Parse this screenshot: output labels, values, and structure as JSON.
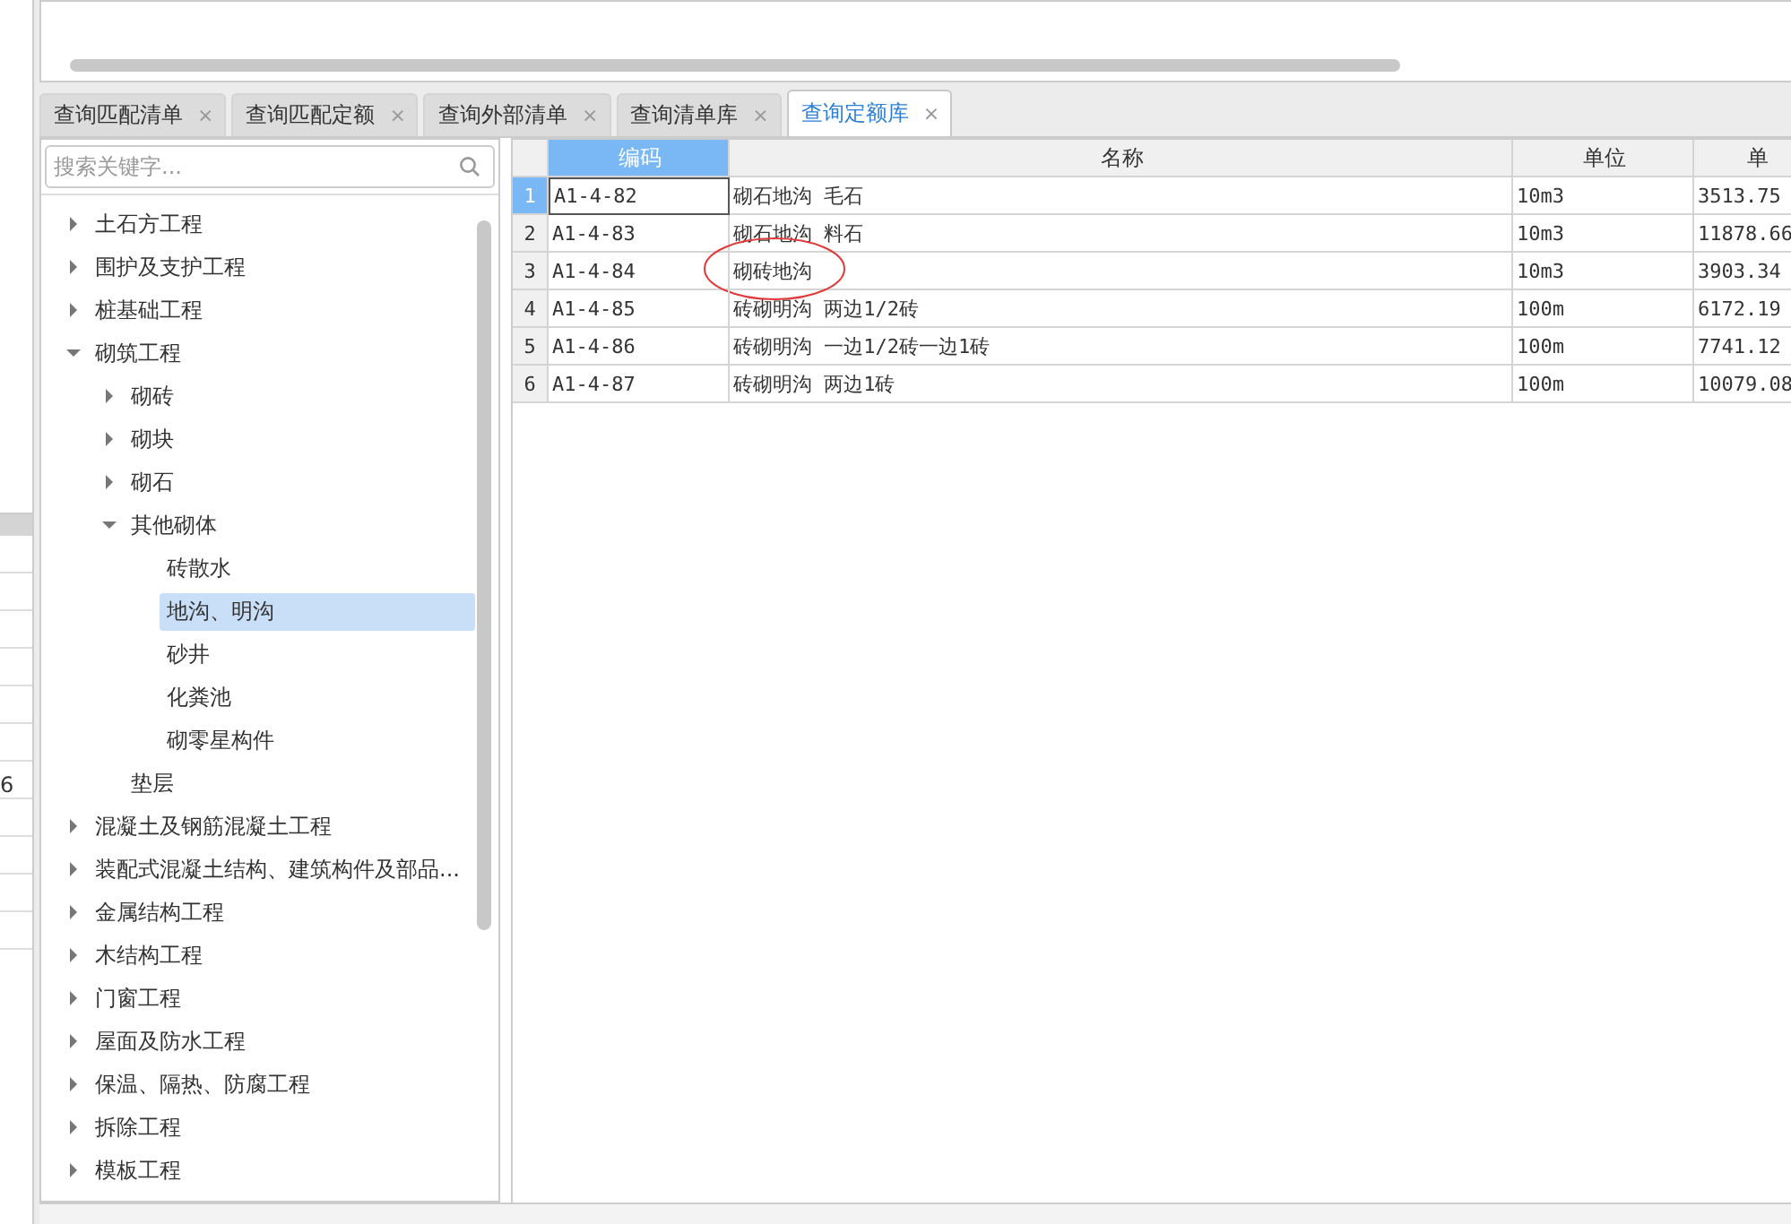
{
  "side_strip": {
    "cell": "6"
  },
  "tabs": [
    {
      "label": "查询匹配清单",
      "selected": false,
      "close": "×"
    },
    {
      "label": "查询匹配定额",
      "selected": false,
      "close": "×"
    },
    {
      "label": "查询外部清单",
      "selected": false,
      "close": "×"
    },
    {
      "label": "查询清单库",
      "selected": false,
      "close": "×"
    },
    {
      "label": "查询定额库",
      "selected": true,
      "close": "×"
    }
  ],
  "search": {
    "placeholder": "搜索关键字..."
  },
  "tree": [
    {
      "label": "土石方工程",
      "expanded": false,
      "selected": false
    },
    {
      "label": "围护及支护工程",
      "expanded": false,
      "selected": false
    },
    {
      "label": "桩基础工程",
      "expanded": false,
      "selected": false
    },
    {
      "label": "砌筑工程",
      "expanded": true,
      "selected": false,
      "children": [
        {
          "label": "砌砖",
          "expanded": false,
          "selected": false
        },
        {
          "label": "砌块",
          "expanded": false,
          "selected": false
        },
        {
          "label": "砌石",
          "expanded": false,
          "selected": false
        },
        {
          "label": "其他砌体",
          "expanded": true,
          "selected": false,
          "children": [
            {
              "label": "砖散水",
              "selected": false
            },
            {
              "label": "地沟、明沟",
              "selected": true
            },
            {
              "label": "砂井",
              "selected": false
            },
            {
              "label": "化粪池",
              "selected": false
            },
            {
              "label": "砌零星构件",
              "selected": false
            }
          ]
        },
        {
          "label": "垫层",
          "selected": false
        }
      ]
    },
    {
      "label": "混凝土及钢筋混凝土工程",
      "expanded": false,
      "selected": false
    },
    {
      "label": "装配式混凝土结构、建筑构件及部品...",
      "expanded": false,
      "selected": false
    },
    {
      "label": "金属结构工程",
      "expanded": false,
      "selected": false
    },
    {
      "label": "木结构工程",
      "expanded": false,
      "selected": false
    },
    {
      "label": "门窗工程",
      "expanded": false,
      "selected": false
    },
    {
      "label": "屋面及防水工程",
      "expanded": false,
      "selected": false
    },
    {
      "label": "保温、隔热、防腐工程",
      "expanded": false,
      "selected": false
    },
    {
      "label": "拆除工程",
      "expanded": false,
      "selected": false
    },
    {
      "label": "模板工程",
      "expanded": false,
      "selected": false
    }
  ],
  "table": {
    "columns": [
      {
        "label": "编码",
        "selected": true
      },
      {
        "label": "名称",
        "selected": false
      },
      {
        "label": "单位",
        "selected": false
      },
      {
        "label": "单",
        "selected": false
      }
    ],
    "rows": [
      {
        "num": "1",
        "selected": true,
        "cells": [
          "A1-4-82",
          "砌石地沟 毛石",
          "10m3",
          "3513.75"
        ]
      },
      {
        "num": "2",
        "selected": false,
        "cells": [
          "A1-4-83",
          "砌石地沟 料石",
          "10m3",
          "11878.66"
        ]
      },
      {
        "num": "3",
        "selected": false,
        "circled": true,
        "cells": [
          "A1-4-84",
          "砌砖地沟",
          "10m3",
          "3903.34"
        ]
      },
      {
        "num": "4",
        "selected": false,
        "cells": [
          "A1-4-85",
          "砖砌明沟 两边1/2砖",
          "100m",
          "6172.19"
        ]
      },
      {
        "num": "5",
        "selected": false,
        "cells": [
          "A1-4-86",
          "砖砌明沟 一边1/2砖一边1砖",
          "100m",
          "7741.12"
        ]
      },
      {
        "num": "6",
        "selected": false,
        "cells": [
          "A1-4-87",
          "砖砌明沟 两边1砖",
          "100m",
          "10079.08"
        ]
      }
    ]
  }
}
